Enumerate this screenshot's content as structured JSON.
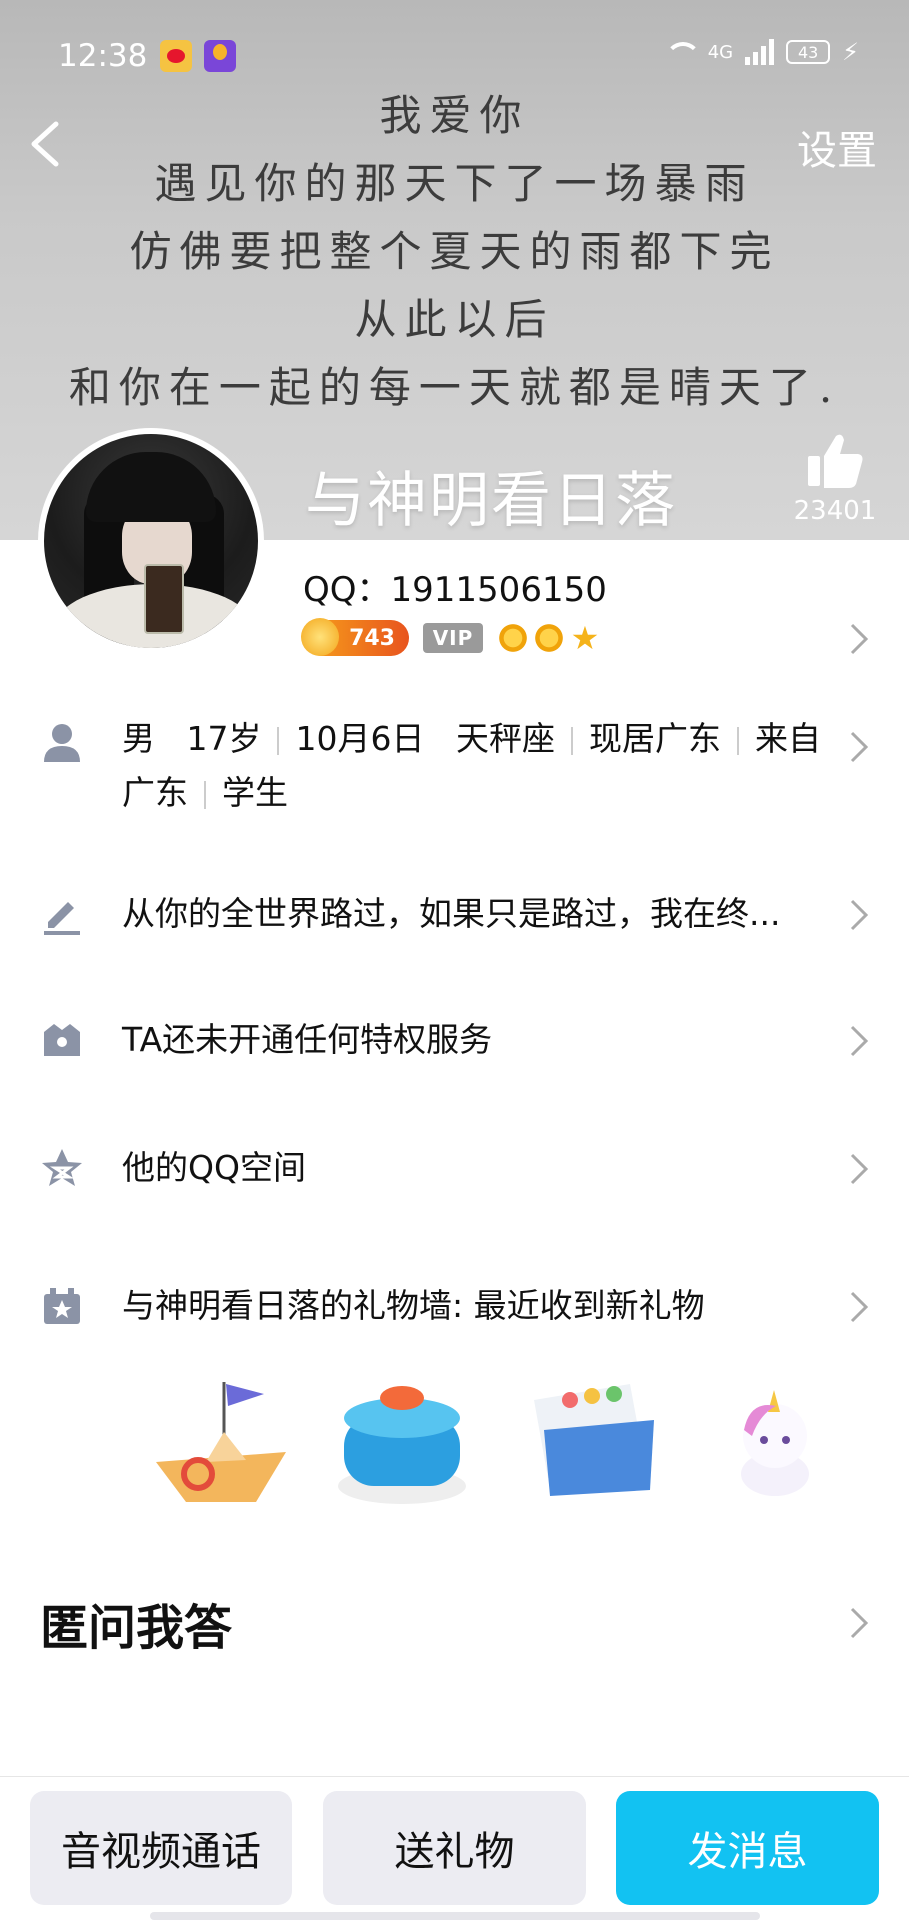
{
  "status_bar": {
    "time": "12:38",
    "network": "4G",
    "battery": "43"
  },
  "header": {
    "back_icon": "chevron-left-icon",
    "settings_label": "设置",
    "poem_lines": [
      "我爱你",
      "遇见你的那天下了一场暴雨",
      "仿佛要把整个夏天的雨都下完",
      "从此以后",
      "和你在一起的每一天就都是晴天了."
    ],
    "nickname": "与神明看日落",
    "like_count": "23401"
  },
  "profile": {
    "qq_label": "QQ：1911506150",
    "level_value": "743",
    "vip_label": "VIP"
  },
  "info_rows": {
    "personal": {
      "icon": "person-icon",
      "gender": "男",
      "age": "17岁",
      "birthday": "10月6日",
      "zodiac": "天秤座",
      "residence": "现居广东",
      "hometown": "来自广东",
      "occupation": "学生"
    },
    "signature": {
      "icon": "pencil-icon",
      "text": "从你的全世界路过，如果只是路过，我在终..."
    },
    "privilege": {
      "icon": "crown-icon",
      "text": "TA还未开通任何特权服务"
    },
    "qzone": {
      "icon": "star-icon",
      "text": "他的QQ空间"
    },
    "gift_wall": {
      "icon": "gift-icon",
      "text": "与神明看日落的礼物墙: 最近收到新礼物",
      "gifts": [
        "paper-boat-icon",
        "birthday-cake-icon",
        "birthday-card-icon",
        "unicorn-icon"
      ]
    }
  },
  "qa_section": {
    "title": "匿问我答"
  },
  "bottom_bar": {
    "call_label": "音视频通话",
    "gift_label": "送礼物",
    "message_label": "发消息"
  },
  "colors": {
    "accent": "#12c2f2",
    "banner": "#c4c4c4",
    "button_bg": "#ececf2"
  }
}
